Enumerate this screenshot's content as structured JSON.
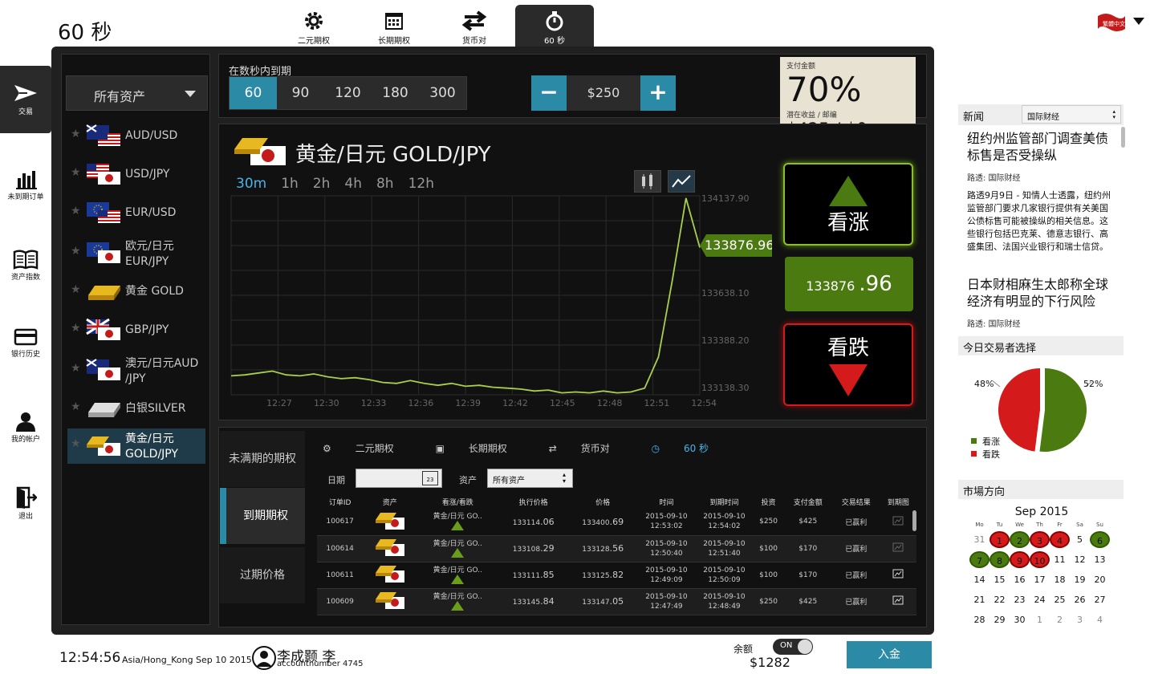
{
  "page_title": "60 秒",
  "top_tabs": [
    {
      "label": "二元期权",
      "icon": "gear-icon"
    },
    {
      "label": "长期期权",
      "icon": "calendar-icon"
    },
    {
      "label": "货币对",
      "icon": "swap-icon"
    },
    {
      "label": "60 秒",
      "icon": "stopwatch-icon",
      "active": true
    }
  ],
  "lang_flag": "繁體中文",
  "nav": [
    {
      "label": "交易",
      "icon": "paper-plane-icon",
      "active": true
    },
    {
      "label": "未到期订单",
      "icon": "bar-chart-icon"
    },
    {
      "label": "资产指数",
      "icon": "book-icon"
    },
    {
      "label": "银行历史",
      "icon": "card-icon"
    },
    {
      "label": "我的帐户",
      "icon": "user-icon"
    },
    {
      "label": "退出",
      "icon": "exit-icon"
    }
  ],
  "asset_filter": "所有资产",
  "assets": [
    {
      "label": "AUD/USD",
      "flag": "au-us"
    },
    {
      "label": "USD/JPY",
      "flag": "us-jp"
    },
    {
      "label": "EUR/USD",
      "flag": "eu-us"
    },
    {
      "label": "欧元/日元 EUR/JPY",
      "flag": "eu-jp"
    },
    {
      "label": "黄金 GOLD",
      "flag": "gold"
    },
    {
      "label": "GBP/JPY",
      "flag": "gb-jp"
    },
    {
      "label": "澳元/日元AUD /JPY",
      "flag": "au-jp"
    },
    {
      "label": "白银SILVER",
      "flag": "silver"
    },
    {
      "label": "黄金/日元 GOLD/JPY",
      "flag": "gold-jp",
      "selected": true
    }
  ],
  "expiry": {
    "label": "在数秒内到期",
    "options": [
      "60",
      "90",
      "120",
      "180",
      "300"
    ],
    "selected": "60"
  },
  "amount": {
    "minus": "−",
    "value": "$250",
    "plus": "+"
  },
  "payout": {
    "label": "支付金额",
    "percent": "70%",
    "sub_label": "潜在收益 / 邮编",
    "value": "$425 / $0"
  },
  "chart": {
    "asset_title": "黄金/日元 GOLD/JPY",
    "timeframes": [
      "30m",
      "1h",
      "2h",
      "4h",
      "8h",
      "12h"
    ],
    "active_tf": "30m",
    "price_tag_main": "133876",
    "price_tag_dec": ".96"
  },
  "chart_data": {
    "type": "line",
    "title": "黄金/日元 GOLD/JPY",
    "x_ticks": [
      "12:27",
      "12:30",
      "12:33",
      "12:36",
      "12:39",
      "12:42",
      "12:45",
      "12:48",
      "12:51",
      "12:54"
    ],
    "y_ticks": [
      "134137.90",
      "133638.10",
      "133388.20",
      "133138.30"
    ],
    "ylim": [
      133100,
      134150
    ],
    "series": [
      {
        "values": [
          133200,
          133205,
          133215,
          133225,
          133205,
          133200,
          133210,
          133195,
          133185,
          133190,
          133180,
          133165,
          133160,
          133175,
          133160,
          133150,
          133160,
          133145,
          133150,
          133140,
          133135,
          133130,
          133120,
          133125,
          133110,
          133115,
          133110,
          133120,
          133110,
          133115,
          133135,
          133300,
          133700,
          134137.9,
          133876.96
        ]
      }
    ]
  },
  "call": {
    "label": "看涨"
  },
  "put": {
    "label": "看跌"
  },
  "current_price": {
    "main": "133876 ",
    "dec": ".96"
  },
  "bottom_nav": [
    "未满期的期权",
    "到期期权",
    "过期价格"
  ],
  "bottom_tabs": [
    {
      "label": "二元期权",
      "icon": "gear-icon"
    },
    {
      "label": "长期期权",
      "icon": "calendar-icon"
    },
    {
      "label": "货币对",
      "icon": "swap-icon"
    },
    {
      "label": "60 秒",
      "icon": "stopwatch-icon",
      "active": true
    }
  ],
  "filters": {
    "date_label": "日期",
    "asset_label": "资产",
    "asset_value": "所有资产",
    "calendar_day": "23"
  },
  "orders": {
    "headers": [
      "订单ID",
      "资产",
      "看涨/看跌",
      "执行价格",
      "价格",
      "时间",
      "到期时间",
      "投资",
      "支付金额",
      "交易结果",
      "到期图"
    ],
    "rows": [
      {
        "id": "100617",
        "asset": "黄金/日元 GO..",
        "strike_main": "133114",
        "strike_dec": ".06",
        "price_main": "133400",
        "price_dec": ".69",
        "time": "2015-09-10 12:53:02",
        "expiry": "2015-09-10 12:54:02",
        "invest": "$250",
        "payout": "$425",
        "result": "已赢利"
      },
      {
        "id": "100614",
        "asset": "黄金/日元 GO..",
        "strike_main": "133108",
        "strike_dec": ".29",
        "price_main": "133128",
        "price_dec": ".56",
        "time": "2015-09-10 12:50:40",
        "expiry": "2015-09-10 12:51:40",
        "invest": "$100",
        "payout": "$170",
        "result": "已赢利"
      },
      {
        "id": "100611",
        "asset": "黄金/日元 GO..",
        "strike_main": "133111",
        "strike_dec": ".85",
        "price_main": "133125",
        "price_dec": ".82",
        "time": "2015-09-10 12:49:09",
        "expiry": "2015-09-10 12:50:09",
        "invest": "$100",
        "payout": "$170",
        "result": "已赢利"
      },
      {
        "id": "100609",
        "asset": "黄金/日元 GO..",
        "strike_main": "133145",
        "strike_dec": ".84",
        "price_main": "133147",
        "price_dec": ".05",
        "time": "2015-09-10 12:47:49",
        "expiry": "2015-09-10 12:48:49",
        "invest": "$250",
        "payout": "$425",
        "result": "已赢利"
      }
    ]
  },
  "news": {
    "header": "新闻",
    "filter": "国际财经",
    "headline1": "纽约州监管部门调查美债标售是否受操纵",
    "src1": "路透: 国际财经",
    "body1": "路透9月9日 - 知情人士透露，纽约州监管部门要求几家银行提供有关美国公债标售可能被操纵的相关信息。这些银行包括巴克莱、德意志银行、高盛集团、法国兴业银行和瑞士信贷。",
    "headline2": "日本财相麻生太郎称全球经济有明显的下行风险",
    "src2": "路透: 国际财经"
  },
  "traders": {
    "header": "今日交易者选择",
    "put_pct": "48%",
    "call_pct": "52%",
    "call_value": 52,
    "put_value": 48,
    "legend_call": "看涨",
    "legend_put": "看跌",
    "colors": {
      "call": "#4a7a10",
      "put": "#d41a1a"
    }
  },
  "market": {
    "header": "市場方向",
    "month": "Sep 2015",
    "weekdays": [
      "Mo",
      "Tu",
      "We",
      "Th",
      "Fr",
      "Sa",
      "Su"
    ],
    "days": [
      {
        "d": "31",
        "s": "gr"
      },
      {
        "d": "1",
        "s": "rd"
      },
      {
        "d": "2",
        "s": "g"
      },
      {
        "d": "3",
        "s": "rd"
      },
      {
        "d": "4",
        "s": "rd"
      },
      {
        "d": "5",
        "s": ""
      },
      {
        "d": "6",
        "s": "g"
      },
      {
        "d": "7",
        "s": "g"
      },
      {
        "d": "8",
        "s": "g"
      },
      {
        "d": "9",
        "s": "rd"
      },
      {
        "d": "10",
        "s": "rd"
      },
      {
        "d": "11",
        "s": ""
      },
      {
        "d": "12",
        "s": ""
      },
      {
        "d": "13",
        "s": ""
      },
      {
        "d": "14",
        "s": ""
      },
      {
        "d": "15",
        "s": ""
      },
      {
        "d": "16",
        "s": ""
      },
      {
        "d": "17",
        "s": ""
      },
      {
        "d": "18",
        "s": ""
      },
      {
        "d": "19",
        "s": ""
      },
      {
        "d": "20",
        "s": ""
      },
      {
        "d": "21",
        "s": ""
      },
      {
        "d": "22",
        "s": ""
      },
      {
        "d": "23",
        "s": ""
      },
      {
        "d": "24",
        "s": ""
      },
      {
        "d": "25",
        "s": ""
      },
      {
        "d": "26",
        "s": ""
      },
      {
        "d": "27",
        "s": ""
      },
      {
        "d": "28",
        "s": ""
      },
      {
        "d": "29",
        "s": ""
      },
      {
        "d": "30",
        "s": ""
      },
      {
        "d": "1",
        "s": "gr"
      },
      {
        "d": "2",
        "s": "gr"
      },
      {
        "d": "3",
        "s": "gr"
      },
      {
        "d": "4",
        "s": "gr"
      }
    ]
  },
  "footer": {
    "time": "12:54:56",
    "tz": "Asia/Hong_Kong Sep 10 2015",
    "user": "李成颢 李",
    "account": "accountnumber 4745",
    "balance_label": "余额",
    "balance": "$1282",
    "toggle": "ON",
    "deposit": "入金"
  }
}
